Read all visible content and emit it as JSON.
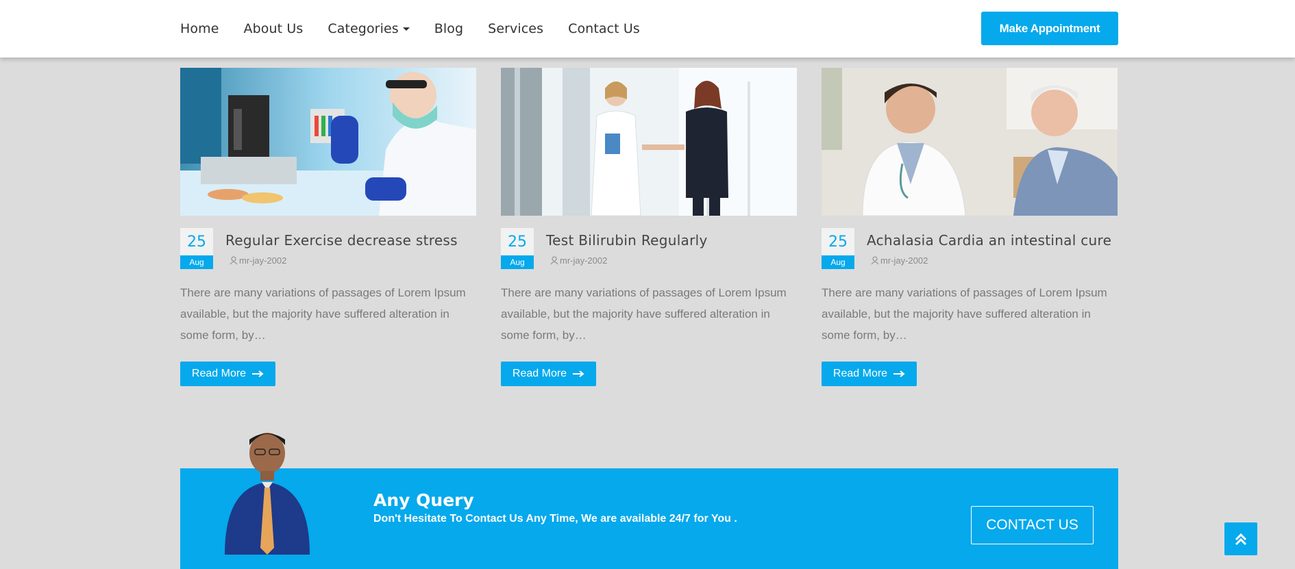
{
  "nav": {
    "items": [
      "Home",
      "About Us",
      "Categories",
      "Blog",
      "Services",
      "Contact Us"
    ],
    "cta": "Make Appointment"
  },
  "posts": [
    {
      "day": "25",
      "month": "Aug",
      "title": "Regular Exercise decrease stress",
      "author": "mr-jay-2002",
      "excerpt": "There are many variations of passages of Lorem Ipsum available, but the majority have suffered alteration in some form, by…",
      "read_more": "Read More"
    },
    {
      "day": "25",
      "month": "Aug",
      "title": "Test Bilirubin Regularly",
      "author": "mr-jay-2002",
      "excerpt": "There are many variations of passages of Lorem Ipsum available, but the majority have suffered alteration in some form, by…",
      "read_more": "Read More"
    },
    {
      "day": "25",
      "month": "Aug",
      "title": "Achalasia Cardia an intestinal cure",
      "author": "mr-jay-2002",
      "excerpt": "There are many variations of passages of Lorem Ipsum available, but the majority have suffered alteration in some form, by…",
      "read_more": "Read More"
    }
  ],
  "query": {
    "title": "Any Query",
    "subtitle": "Don't Hesitate To Contact Us Any Time, We are available 24/7 for You .",
    "button": "CONTACT US"
  },
  "colors": {
    "accent": "#05a9ec",
    "background": "#dcdcdc"
  },
  "icons": {
    "author": "user-icon",
    "read_more": "arrow-right-icon",
    "scroll_top": "double-chevron-up-icon"
  }
}
